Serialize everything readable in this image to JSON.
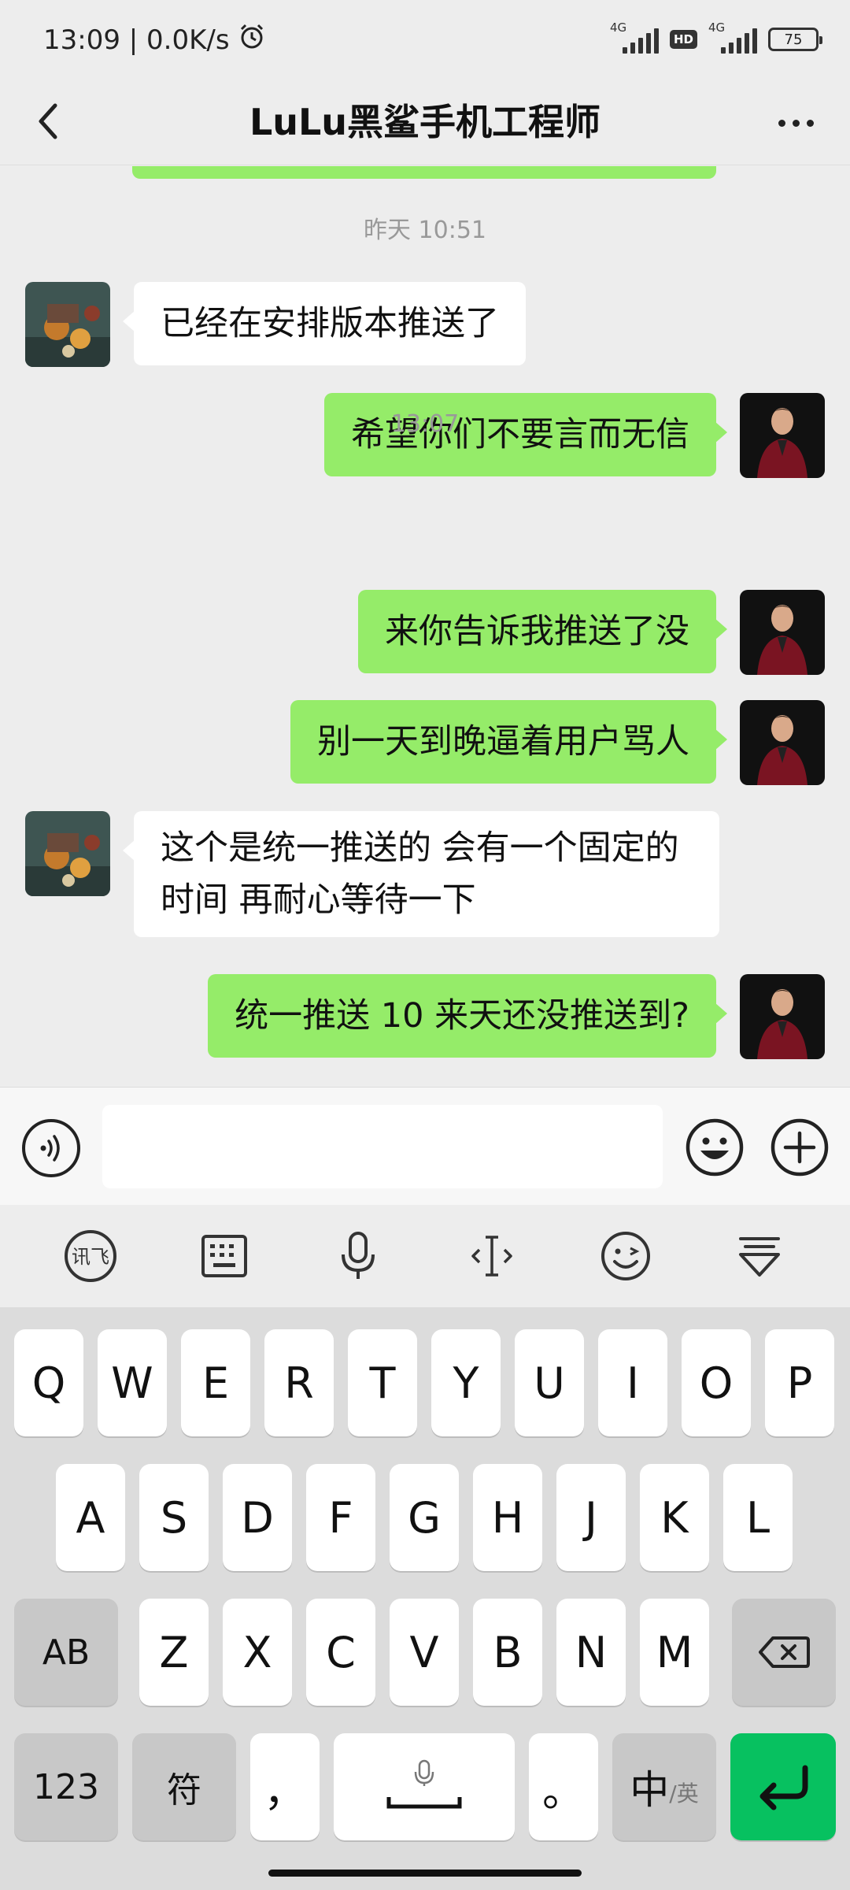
{
  "status_bar": {
    "time_speed": "13:09 | 0.0K/s",
    "net1": "4G",
    "hd": "HD",
    "net2": "4G",
    "battery": "75"
  },
  "nav": {
    "title": "LuLu黑鲨手机工程师"
  },
  "chat": {
    "timestamps": [
      "昨天 10:51",
      "13:07"
    ],
    "messages": [
      {
        "side": "in",
        "text": "已经在安排版本推送了"
      },
      {
        "side": "out",
        "text": "希望你们不要言而无信"
      },
      {
        "side": "out",
        "text": "来你告诉我推送了没"
      },
      {
        "side": "out",
        "text": "别一天到晚逼着用户骂人"
      },
      {
        "side": "in",
        "text": "这个是统一推送的 会有一个固定的时间 再耐心等待一下"
      },
      {
        "side": "out",
        "text": "统一推送 10 来天还没推送到?"
      }
    ]
  },
  "input": {
    "value": "",
    "placeholder": ""
  },
  "keyboard": {
    "row1": [
      "Q",
      "W",
      "E",
      "R",
      "T",
      "Y",
      "U",
      "I",
      "O",
      "P"
    ],
    "row2": [
      "A",
      "S",
      "D",
      "F",
      "G",
      "H",
      "J",
      "K",
      "L"
    ],
    "row3": [
      "Z",
      "X",
      "C",
      "V",
      "B",
      "N",
      "M"
    ],
    "shift_label": "AB",
    "num_label": "123",
    "symbol_label": "符",
    "comma": "，",
    "period": "。",
    "lang_main": "中",
    "lang_sub": "/英"
  },
  "colors": {
    "outgoing_bubble": "#95ec69",
    "incoming_bubble": "#ffffff",
    "enter_key": "#07c160"
  },
  "icons": [
    "back-arrow-icon",
    "more-icon",
    "voice-icon",
    "emoji-icon",
    "plus-icon",
    "xunfei-icon",
    "keyboard-icon",
    "microphone-icon",
    "cursor-icon",
    "emoticon-icon",
    "collapse-icon",
    "backspace-icon",
    "enter-icon",
    "alarm-icon"
  ]
}
